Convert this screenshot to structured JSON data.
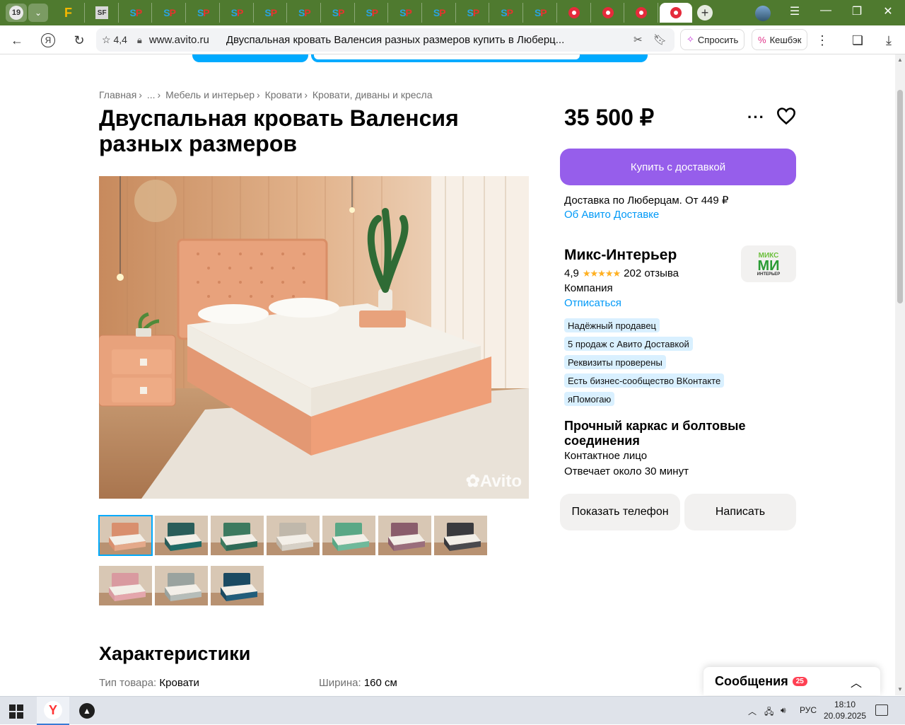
{
  "browser": {
    "tab_count": "19",
    "tabs": [
      {
        "icon": "F",
        "kind": "f"
      },
      {
        "icon": "SF",
        "kind": "sf"
      },
      {
        "icon": "SP",
        "kind": "sp"
      },
      {
        "icon": "SP",
        "kind": "sp"
      },
      {
        "icon": "SP",
        "kind": "sp"
      },
      {
        "icon": "SP",
        "kind": "sp"
      },
      {
        "icon": "SP",
        "kind": "sp"
      },
      {
        "icon": "SP",
        "kind": "sp"
      },
      {
        "icon": "SP",
        "kind": "sp"
      },
      {
        "icon": "SP",
        "kind": "sp"
      },
      {
        "icon": "SP",
        "kind": "sp"
      },
      {
        "icon": "SP",
        "kind": "sp"
      },
      {
        "icon": "SP",
        "kind": "sp"
      },
      {
        "icon": "SP",
        "kind": "sp"
      },
      {
        "icon": "SP",
        "kind": "sp"
      },
      {
        "icon": "avito",
        "kind": "red"
      },
      {
        "icon": "avito",
        "kind": "red"
      },
      {
        "icon": "avito",
        "kind": "red"
      },
      {
        "icon": "avito",
        "kind": "red-active"
      }
    ],
    "rating": "4,4",
    "host": "www.avito.ru",
    "page_title": "Двуспальная кровать Валенсия разных размеров купить в Люберц...",
    "ask_label": "Спросить",
    "cashback_label": "Кешбэк"
  },
  "breadcrumbs": [
    "Главная",
    "...",
    "Мебель и интерьер",
    "Кровати",
    "Кровати, диваны и кресла"
  ],
  "product": {
    "title": "Двуспальная кровать Валенсия разных размеров",
    "price": "35 500 ₽",
    "watermark": "Avito",
    "buy_label": "Купить с доставкой",
    "delivery_text": "Доставка по Люберцам. От 449 ₽",
    "delivery_link": "Об Авито Доставке",
    "thumbnails": [
      {
        "color": "#e4a98a",
        "frame": "#d98f6e"
      },
      {
        "color": "#1f6b66",
        "frame": "#2a5d5a"
      },
      {
        "color": "#2f6b57",
        "frame": "#3d7a5f"
      },
      {
        "color": "#d6d0c6",
        "frame": "#c0b8ab"
      },
      {
        "color": "#6fb99a",
        "frame": "#5aa886"
      },
      {
        "color": "#9a6e7c",
        "frame": "#8a5d6c"
      },
      {
        "color": "#4a4a4e",
        "frame": "#3a3a3e"
      },
      {
        "color": "#e4a6ac",
        "frame": "#d99aa0"
      },
      {
        "color": "#b6bdb9",
        "frame": "#9aa39f"
      },
      {
        "color": "#215d7a",
        "frame": "#1a4a62"
      }
    ]
  },
  "seller": {
    "name": "Микс-Интерьер",
    "logo_top": "МИКС",
    "logo_mid": "МИ",
    "logo_bottom": "ИНТЕРЬЕР",
    "rating": "4,9",
    "stars": "★★★★★",
    "reviews": "202 отзыва",
    "type": "Компания",
    "unsubscribe": "Отписаться",
    "badges": [
      "Надёжный продавец",
      "5 продаж с Авито Доставкой",
      "Реквизиты проверены",
      "Есть бизнес-сообщество ВКонтакте",
      "яПомогаю"
    ],
    "tagline": "Прочный каркас и болтовые соединения",
    "contact": "Контактное лицо",
    "answers": "Отвечает около 30 минут",
    "show_phone": "Показать телефон",
    "write": "Написать"
  },
  "characteristics": {
    "heading": "Характеристики",
    "rows": [
      {
        "key": "Тип товара:",
        "value": "Кровати"
      },
      {
        "key": "Ширина:",
        "value": "160 см"
      }
    ]
  },
  "messages": {
    "label": "Сообщения",
    "count": "25"
  },
  "taskbar": {
    "lang": "РУС",
    "time": "18:10",
    "date": "20.09.2025"
  },
  "colors": {
    "accent": "#965eeb",
    "link": "#0099f7",
    "badge_bg": "#d9f0ff",
    "tabbar": "#4f7a2f"
  }
}
